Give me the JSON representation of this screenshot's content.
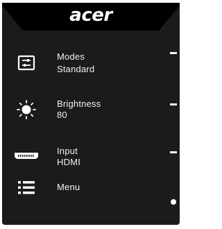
{
  "brand": "acer",
  "menu_items": [
    {
      "icon": "modes-icon",
      "label": "Modes",
      "value": "Standard"
    },
    {
      "icon": "brightness-icon",
      "label": "Brightness",
      "value": "80"
    },
    {
      "icon": "hdmi-input-icon",
      "label": "Input",
      "value": "HDMI"
    },
    {
      "icon": "menu-icon",
      "label": "Menu",
      "value": ""
    }
  ],
  "keys": [
    "dash",
    "dash",
    "dash",
    "dot"
  ],
  "colors": {
    "panel": "#1b1b1b",
    "header": "#000000",
    "text": "#ffffff"
  }
}
